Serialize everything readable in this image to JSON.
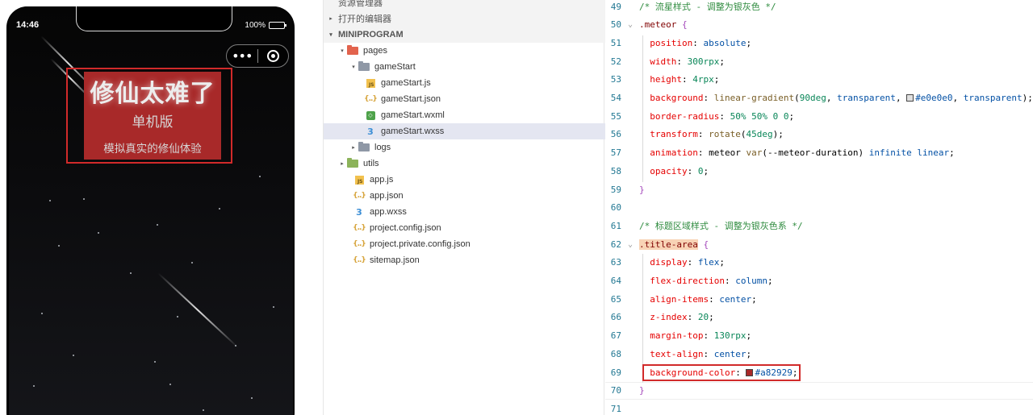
{
  "phone": {
    "status_time": "14:46",
    "battery_text": "100%",
    "capsule_menu_label": "•••",
    "title_main": "修仙太难了",
    "title_sub": "单机版",
    "title_desc": "模拟真实的修仙体验",
    "title_bg_color": "#a82929"
  },
  "explorer": {
    "rows": [
      {
        "label": "资源管理器",
        "kind": "section"
      },
      {
        "label": "打开的编辑器",
        "kind": "section",
        "arrow": "▸"
      },
      {
        "label": "MINIPROGRAM",
        "kind": "section-bold",
        "arrow": "▾"
      },
      {
        "label": "pages",
        "kind": "folder",
        "icon": "folder-red",
        "arrow": "▾",
        "indent": 1
      },
      {
        "label": "gameStart",
        "kind": "folder",
        "icon": "folder-gray",
        "arrow": "▾",
        "indent": 2
      },
      {
        "label": "gameStart.js",
        "kind": "file",
        "icon": "js",
        "indent": 3
      },
      {
        "label": "gameStart.json",
        "kind": "file",
        "icon": "json",
        "indent": 3
      },
      {
        "label": "gameStart.wxml",
        "kind": "file",
        "icon": "wxml",
        "indent": 3
      },
      {
        "label": "gameStart.wxss",
        "kind": "file",
        "icon": "wxss",
        "indent": 3,
        "selected": true
      },
      {
        "label": "logs",
        "kind": "folder",
        "icon": "folder-gray",
        "arrow": "▸",
        "indent": 2
      },
      {
        "label": "utils",
        "kind": "folder",
        "icon": "folder-green",
        "arrow": "▸",
        "indent": 1
      },
      {
        "label": "app.js",
        "kind": "file",
        "icon": "js",
        "indent": 2
      },
      {
        "label": "app.json",
        "kind": "file",
        "icon": "json",
        "indent": 2
      },
      {
        "label": "app.wxss",
        "kind": "file",
        "icon": "wxss",
        "indent": 2
      },
      {
        "label": "project.config.json",
        "kind": "file",
        "icon": "json",
        "indent": 2
      },
      {
        "label": "project.private.config.json",
        "kind": "file",
        "icon": "json",
        "indent": 2
      },
      {
        "label": "sitemap.json",
        "kind": "file",
        "icon": "json",
        "indent": 2
      }
    ],
    "icon_glyphs": {
      "js": "JS",
      "json": "{..}",
      "wxml": "◇",
      "wxss": "3"
    }
  },
  "editor": {
    "lines": [
      {
        "n": "49",
        "tokens": [
          [
            "c-comment",
            "/* 流星样式 - 调整为银灰色 */"
          ]
        ]
      },
      {
        "n": "50",
        "fold": "⌄",
        "tokens": [
          [
            "c-sel",
            ".meteor"
          ],
          [
            "c-punc",
            " "
          ],
          [
            "c-brace",
            "{"
          ]
        ]
      },
      {
        "n": "51",
        "tokens": [
          [
            "c-punc",
            "  "
          ],
          [
            "c-prop",
            "position"
          ],
          [
            "c-punc",
            ": "
          ],
          [
            "c-val",
            "absolute"
          ],
          [
            "c-punc",
            ";"
          ]
        ]
      },
      {
        "n": "52",
        "tokens": [
          [
            "c-punc",
            "  "
          ],
          [
            "c-prop",
            "width"
          ],
          [
            "c-punc",
            ": "
          ],
          [
            "c-num",
            "300rpx"
          ],
          [
            "c-punc",
            ";"
          ]
        ]
      },
      {
        "n": "53",
        "tokens": [
          [
            "c-punc",
            "  "
          ],
          [
            "c-prop",
            "height"
          ],
          [
            "c-punc",
            ": "
          ],
          [
            "c-num",
            "4rpx"
          ],
          [
            "c-punc",
            ";"
          ]
        ]
      },
      {
        "n": "54",
        "tokens": [
          [
            "c-punc",
            "  "
          ],
          [
            "c-prop",
            "background"
          ],
          [
            "c-punc",
            ": "
          ],
          [
            "c-func",
            "linear-gradient"
          ],
          [
            "c-punc",
            "("
          ],
          [
            "c-num",
            "90deg"
          ],
          [
            "c-punc",
            ", "
          ],
          [
            "c-val",
            "transparent"
          ],
          [
            "c-punc",
            ", "
          ],
          [
            "swatch:#e0e0e0",
            ""
          ],
          [
            "c-val",
            "#e0e0e0"
          ],
          [
            "c-punc",
            ", "
          ],
          [
            "c-val",
            "transparent"
          ],
          [
            "c-punc",
            ");"
          ]
        ]
      },
      {
        "n": "55",
        "tokens": [
          [
            "c-punc",
            "  "
          ],
          [
            "c-prop",
            "border-radius"
          ],
          [
            "c-punc",
            ": "
          ],
          [
            "c-num",
            "50% 50% 0 0"
          ],
          [
            "c-punc",
            ";"
          ]
        ]
      },
      {
        "n": "56",
        "tokens": [
          [
            "c-punc",
            "  "
          ],
          [
            "c-prop",
            "transform"
          ],
          [
            "c-punc",
            ": "
          ],
          [
            "c-func",
            "rotate"
          ],
          [
            "c-punc",
            "("
          ],
          [
            "c-num",
            "45deg"
          ],
          [
            "c-punc",
            ");"
          ]
        ]
      },
      {
        "n": "57",
        "tokens": [
          [
            "c-punc",
            "  "
          ],
          [
            "c-prop",
            "animation"
          ],
          [
            "c-punc",
            ": meteor "
          ],
          [
            "c-func",
            "var"
          ],
          [
            "c-punc",
            "(--meteor-duration) "
          ],
          [
            "c-val",
            "infinite linear"
          ],
          [
            "c-punc",
            ";"
          ]
        ]
      },
      {
        "n": "58",
        "tokens": [
          [
            "c-punc",
            "  "
          ],
          [
            "c-prop",
            "opacity"
          ],
          [
            "c-punc",
            ": "
          ],
          [
            "c-num",
            "0"
          ],
          [
            "c-punc",
            ";"
          ]
        ]
      },
      {
        "n": "59",
        "tokens": [
          [
            "c-brace",
            "}"
          ]
        ]
      },
      {
        "n": "60",
        "tokens": []
      },
      {
        "n": "61",
        "tokens": [
          [
            "c-comment",
            "/* 标题区域样式 - 调整为银灰色系 */"
          ]
        ]
      },
      {
        "n": "62",
        "fold": "⌄",
        "tokens": [
          [
            "c-sel hl-word",
            ".title-area"
          ],
          [
            "c-punc",
            " "
          ],
          [
            "c-brace",
            "{"
          ]
        ]
      },
      {
        "n": "63",
        "tokens": [
          [
            "c-punc",
            "  "
          ],
          [
            "c-prop",
            "display"
          ],
          [
            "c-punc",
            ": "
          ],
          [
            "c-val",
            "flex"
          ],
          [
            "c-punc",
            ";"
          ]
        ]
      },
      {
        "n": "64",
        "tokens": [
          [
            "c-punc",
            "  "
          ],
          [
            "c-prop",
            "flex-direction"
          ],
          [
            "c-punc",
            ": "
          ],
          [
            "c-val",
            "column"
          ],
          [
            "c-punc",
            ";"
          ]
        ]
      },
      {
        "n": "65",
        "tokens": [
          [
            "c-punc",
            "  "
          ],
          [
            "c-prop",
            "align-items"
          ],
          [
            "c-punc",
            ": "
          ],
          [
            "c-val",
            "center"
          ],
          [
            "c-punc",
            ";"
          ]
        ]
      },
      {
        "n": "66",
        "tokens": [
          [
            "c-punc",
            "  "
          ],
          [
            "c-prop",
            "z-index"
          ],
          [
            "c-punc",
            ": "
          ],
          [
            "c-num",
            "20"
          ],
          [
            "c-punc",
            ";"
          ]
        ]
      },
      {
        "n": "67",
        "tokens": [
          [
            "c-punc",
            "  "
          ],
          [
            "c-prop",
            "margin-top"
          ],
          [
            "c-punc",
            ": "
          ],
          [
            "c-num",
            "130rpx"
          ],
          [
            "c-punc",
            ";"
          ]
        ]
      },
      {
        "n": "68",
        "tokens": [
          [
            "c-punc",
            "  "
          ],
          [
            "c-prop",
            "text-align"
          ],
          [
            "c-punc",
            ": "
          ],
          [
            "c-val",
            "center"
          ],
          [
            "c-punc",
            ";"
          ]
        ]
      },
      {
        "n": "69",
        "tokens": [
          [
            "c-punc",
            "  "
          ],
          [
            "c-prop",
            "background-color"
          ],
          [
            "c-punc",
            ": "
          ],
          [
            "swatch:#a82929",
            ""
          ],
          [
            "c-val",
            "#a82929"
          ],
          [
            "c-punc",
            ";"
          ]
        ]
      },
      {
        "n": "70",
        "tokens": [
          [
            "c-brace",
            "}"
          ]
        ]
      },
      {
        "n": "71",
        "tokens": []
      }
    ]
  }
}
